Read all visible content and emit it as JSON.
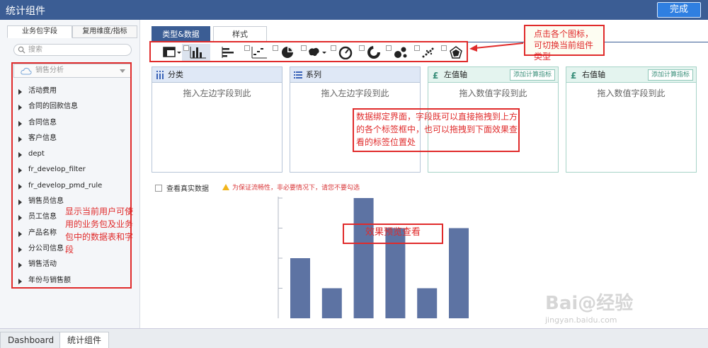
{
  "header": {
    "title": "统计组件",
    "done_label": "完成"
  },
  "left": {
    "tabs": [
      "业务包字段",
      "复用维度/指标"
    ],
    "search_placeholder": "搜索",
    "package": "销售分析",
    "tree": [
      "活动费用",
      "合同的回款信息",
      "合同信息",
      "客户信息",
      "dept",
      "fr_develop_filter",
      "fr_develop_pmd_rule",
      "销售员信息",
      "员工信息",
      "产品名称",
      "分公司信息",
      "销售活动",
      "年份与销售额"
    ],
    "annotation": "显示当前用户可使用的业务包及业务包中的数据表和字段"
  },
  "main": {
    "tabs": [
      "类型&数据",
      "样式"
    ],
    "chart_type_note": "点击各个图标，可切换当前组件类型",
    "zones": [
      {
        "title": "分类",
        "drop": "拖入左边字段到此"
      },
      {
        "title": "系列",
        "drop": "拖入左边字段到此"
      },
      {
        "title": "左值轴",
        "drop": "拖入数值字段到此",
        "add": "添加计算指标"
      },
      {
        "title": "右值轴",
        "drop": "拖入数值字段到此",
        "add": "添加计算指标"
      }
    ],
    "binding_note": "数据绑定界面，字段既可以直接拖拽到上方的各个标签框中，也可以拖拽到下面效果查看的标签位置处",
    "real_data_label": "查看真实数据",
    "warning": "为保证流畅性，非必要情况下，请您不要勾选",
    "preview_note": "效果预览查看"
  },
  "chart_data": {
    "type": "bar",
    "values": [
      2,
      1,
      4,
      3,
      1,
      3
    ],
    "ylim": [
      0,
      4
    ],
    "color": "#5d73a3"
  },
  "bottom": {
    "tabs": [
      "Dashboard",
      "统计组件"
    ]
  },
  "watermark": {
    "main": "Bai@经验",
    "sub": "jingyan.baidu.com"
  }
}
